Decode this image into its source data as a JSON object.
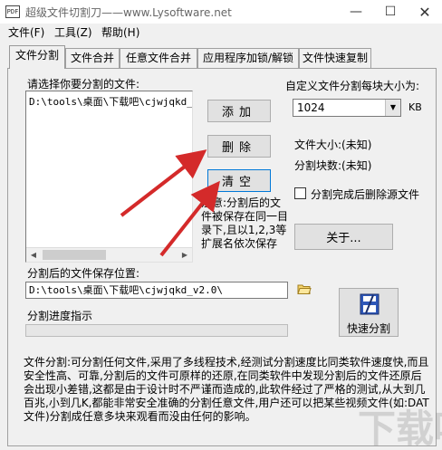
{
  "window": {
    "icon_text": "PDF",
    "title": "超级文件切割刀——www.Lysoftware.net",
    "minimize": "—",
    "maximize": "☐",
    "close": "✕"
  },
  "menu": [
    "文件(F)",
    "工具(Z)",
    "帮助(H)"
  ],
  "tabs": [
    "文件分割",
    "文件合并",
    "任意文件合并",
    "应用程序加锁/解锁",
    "文件快速复制"
  ],
  "split": {
    "select_label": "请选择你要分割的文件:",
    "file_list": [
      "D:\\tools\\桌面\\下载吧\\cjwjqkd_v"
    ],
    "add_button": "添加",
    "delete_button": "删除",
    "clear_button": "清空",
    "size_label": "自定义文件分割每块大小为:",
    "size_value": "1024",
    "size_unit": "KB",
    "file_size": "文件大小:(未知)",
    "block_count": "分割块数:(未知)",
    "delete_source": "分割完成后删除源文件",
    "note": "注意:分割后的文件被保存在同一目录下,且以1,2,3等扩展名依次保存",
    "about_button": "关于...",
    "save_label": "分割后的文件保存位置:",
    "save_path": "D:\\tools\\桌面\\下载吧\\cjwjqkd_v2.0\\",
    "progress_label": "分割进度指示",
    "progress": 0,
    "quick_split_button": "快速分割",
    "description": "文件分割:可分割任何文件,采用了多线程技术,经测试分割速度比同类软件速度快,而且安全性高、可靠,分割后的文件可原样的还原,在同类软件中发现分割后的文件还原后会出现小差错,这都是由于设计时不严谨而造成的,此软件经过了严格的测试,从大到几百兆,小到几K,都能非常安全准确的分割任意文件,用户还可以把某些视频文件(如:DAT文件)分割成任意多块来观看而没由任何的影响。"
  },
  "watermark": "下载吧",
  "colors": {
    "arrow": "#d42a2a",
    "progress": "#06b025",
    "focus": "#0078d7"
  }
}
